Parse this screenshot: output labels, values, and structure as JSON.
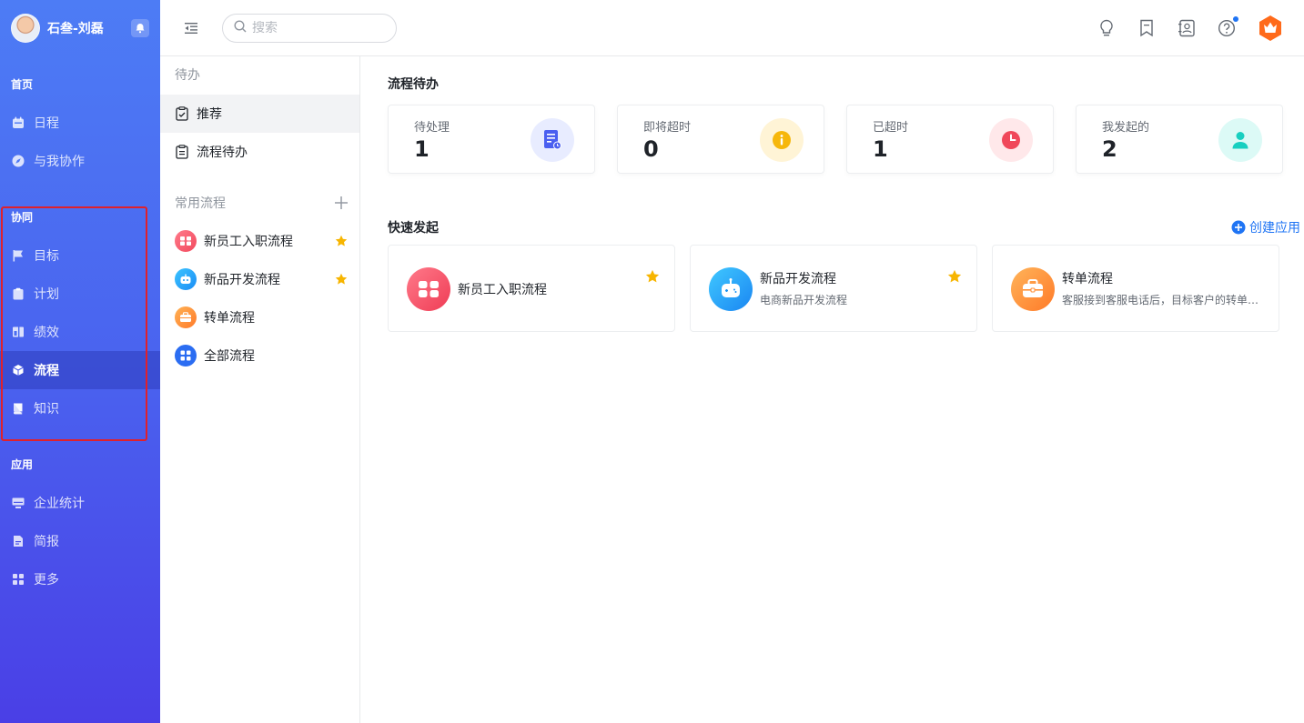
{
  "user": {
    "name": "石叁-刘磊"
  },
  "sidebar": {
    "sections": [
      {
        "title": "首页",
        "items": [
          {
            "label": "日程",
            "icon": "calendar-icon"
          },
          {
            "label": "与我协作",
            "icon": "compass-icon"
          }
        ]
      },
      {
        "title": "协同",
        "items": [
          {
            "label": "目标",
            "icon": "flag-icon"
          },
          {
            "label": "计划",
            "icon": "clipboard-icon"
          },
          {
            "label": "绩效",
            "icon": "performance-icon"
          },
          {
            "label": "流程",
            "icon": "cube-icon"
          },
          {
            "label": "知识",
            "icon": "book-icon"
          }
        ]
      },
      {
        "title": "应用",
        "items": [
          {
            "label": "企业统计",
            "icon": "monitor-icon"
          },
          {
            "label": "简报",
            "icon": "document-icon"
          },
          {
            "label": "更多",
            "icon": "grid-icon"
          }
        ]
      }
    ],
    "active": "流程"
  },
  "topbar": {
    "search_placeholder": "搜索"
  },
  "midpanel": {
    "todo_label": "待办",
    "todo_items": [
      {
        "label": "推荐"
      },
      {
        "label": "流程待办"
      }
    ],
    "common_label": "常用流程",
    "flows": [
      {
        "label": "新员工入职流程",
        "starred": true,
        "color": "#f2495d"
      },
      {
        "label": "新品开发流程",
        "starred": true,
        "color": "#1aa3f5"
      },
      {
        "label": "转单流程",
        "starred": false,
        "color": "#ff8a33"
      },
      {
        "label": "全部流程",
        "starred": false,
        "color": "#2b6df2"
      }
    ]
  },
  "main": {
    "pending_title": "流程待办",
    "stats": [
      {
        "label": "待处理",
        "value": "1",
        "icon": "document-clock-icon",
        "bg": "#e8ecff",
        "fg": "#4a5ff0"
      },
      {
        "label": "即将超时",
        "value": "0",
        "icon": "info-icon",
        "bg": "#fff4d6",
        "fg": "#f6b70c"
      },
      {
        "label": "已超时",
        "value": "1",
        "icon": "clock-icon",
        "bg": "#ffe8ea",
        "fg": "#f0485a"
      },
      {
        "label": "我发起的",
        "value": "2",
        "icon": "person-icon",
        "bg": "#dcfaf6",
        "fg": "#18cfc0"
      }
    ],
    "quick_title": "快速发起",
    "create_app": "创建应用",
    "quick_cards": [
      {
        "name": "新员工入职流程",
        "desc": "",
        "starred": true
      },
      {
        "name": "新品开发流程",
        "desc": "电商新品开发流程",
        "starred": true
      },
      {
        "name": "转单流程",
        "desc": "客服接到客服电话后，目标客户的转单流程",
        "starred": false
      }
    ]
  },
  "colors": {
    "accent": "#1f74f4",
    "star": "#f7b500",
    "highlight": "#e0202b"
  }
}
